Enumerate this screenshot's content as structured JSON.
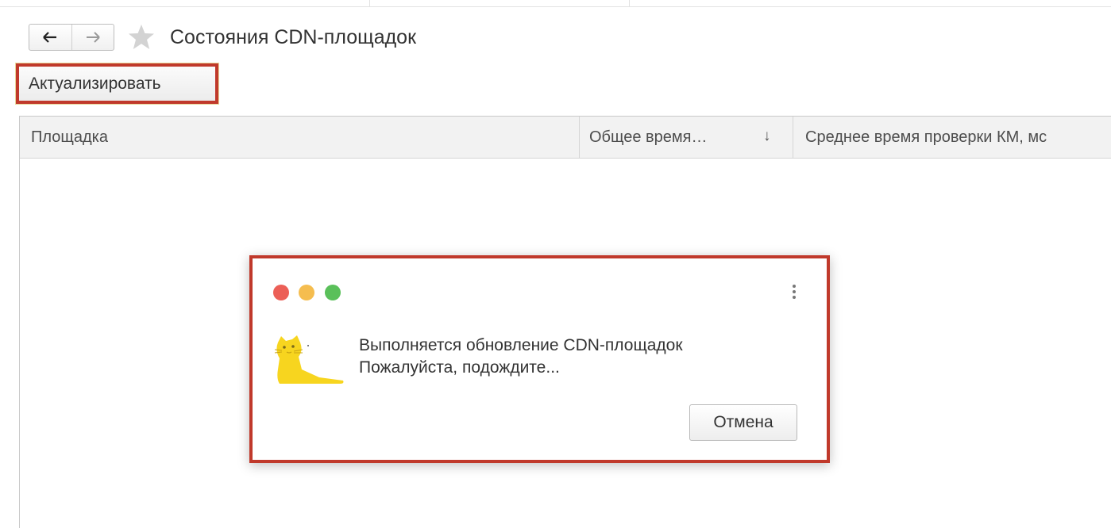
{
  "header": {
    "title": "Состояния CDN-площадок",
    "back_icon": "arrow-left-icon",
    "forward_icon": "arrow-right-icon",
    "favorite_icon": "star-icon"
  },
  "toolbar": {
    "update_label": "Актуализировать"
  },
  "table": {
    "columns": [
      {
        "label": "Площадка"
      },
      {
        "label": "Общее время…",
        "sort": "↓"
      },
      {
        "label": "Среднее время проверки КМ, мс"
      }
    ],
    "rows": []
  },
  "dialog": {
    "window_controls": [
      "red",
      "yellow",
      "green"
    ],
    "message_line1": "Выполняется обновление CDN-площадок",
    "message_line2": "Пожалуйста, подождите...",
    "cancel_label": "Отмена",
    "image": "yellow-cat-icon",
    "menu_icon": "kebab-menu-icon"
  },
  "colors": {
    "highlight_border": "#c0392b",
    "dot_red": "#ec5f57",
    "dot_yellow": "#f5bd4f",
    "dot_green": "#5ac05a",
    "cat_yellow": "#f7d51f"
  }
}
